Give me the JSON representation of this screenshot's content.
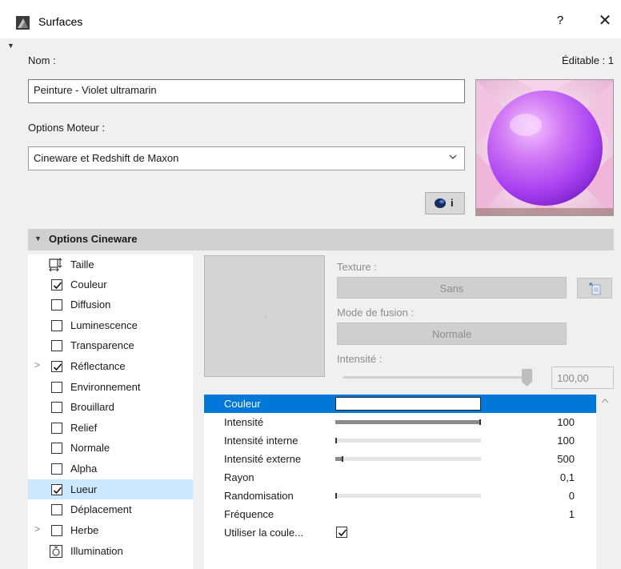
{
  "window": {
    "title": "Surfaces",
    "help": "?",
    "close": "✕"
  },
  "header": {
    "name_label": "Nom :",
    "editable": "Éditable : 1"
  },
  "name_field": {
    "value": "Peinture - Violet ultramarin"
  },
  "engine": {
    "label": "Options Moteur :",
    "value": "Cineware et Redshift de Maxon"
  },
  "info_button": {
    "label": "i"
  },
  "section": {
    "title": "Options Cineware"
  },
  "channels": [
    {
      "label": "Taille",
      "kind": "icon",
      "icon": "size-icon"
    },
    {
      "label": "Couleur",
      "kind": "check",
      "checked": true
    },
    {
      "label": "Diffusion",
      "kind": "check",
      "checked": false
    },
    {
      "label": "Luminescence",
      "kind": "check",
      "checked": false
    },
    {
      "label": "Transparence",
      "kind": "check",
      "checked": false
    },
    {
      "label": "Réflectance",
      "kind": "check",
      "checked": true,
      "expander": ">"
    },
    {
      "label": "Environnement",
      "kind": "check",
      "checked": false
    },
    {
      "label": "Brouillard",
      "kind": "check",
      "checked": false
    },
    {
      "label": "Relief",
      "kind": "check",
      "checked": false
    },
    {
      "label": "Normale",
      "kind": "check",
      "checked": false
    },
    {
      "label": "Alpha",
      "kind": "check",
      "checked": false
    },
    {
      "label": "Lueur",
      "kind": "check",
      "checked": true,
      "selected": true
    },
    {
      "label": "Déplacement",
      "kind": "check",
      "checked": false
    },
    {
      "label": "Herbe",
      "kind": "check",
      "checked": false,
      "expander": ">"
    },
    {
      "label": "Illumination",
      "kind": "icon",
      "icon": "illumination-icon"
    }
  ],
  "texture": {
    "label": "Texture :",
    "value": "Sans",
    "blend_label": "Mode de fusion :",
    "blend_value": "Normale",
    "intensity_label": "Intensité :",
    "intensity_value": "100,00",
    "intensity_fraction": 1.0
  },
  "params": [
    {
      "name": "Couleur",
      "type": "color",
      "color": "#ffffff",
      "selected": true
    },
    {
      "name": "Intensité",
      "type": "slider",
      "value": "100",
      "fraction": 1.0
    },
    {
      "name": "Intensité interne",
      "type": "slider",
      "value": "100",
      "fraction": 0.0
    },
    {
      "name": "Intensité externe",
      "type": "slider",
      "value": "500",
      "fraction": 0.05
    },
    {
      "name": "Rayon",
      "type": "value",
      "value": "0,1"
    },
    {
      "name": "Randomisation",
      "type": "slider",
      "value": "0",
      "fraction": 0.0
    },
    {
      "name": "Fréquence",
      "type": "value",
      "value": "1"
    },
    {
      "name": "Utiliser la coule...",
      "type": "checkbox",
      "checked": true
    }
  ],
  "colors": {
    "accent": "#0078d7",
    "selection_light": "#cce8ff",
    "section_bg": "#d0d0d0"
  }
}
